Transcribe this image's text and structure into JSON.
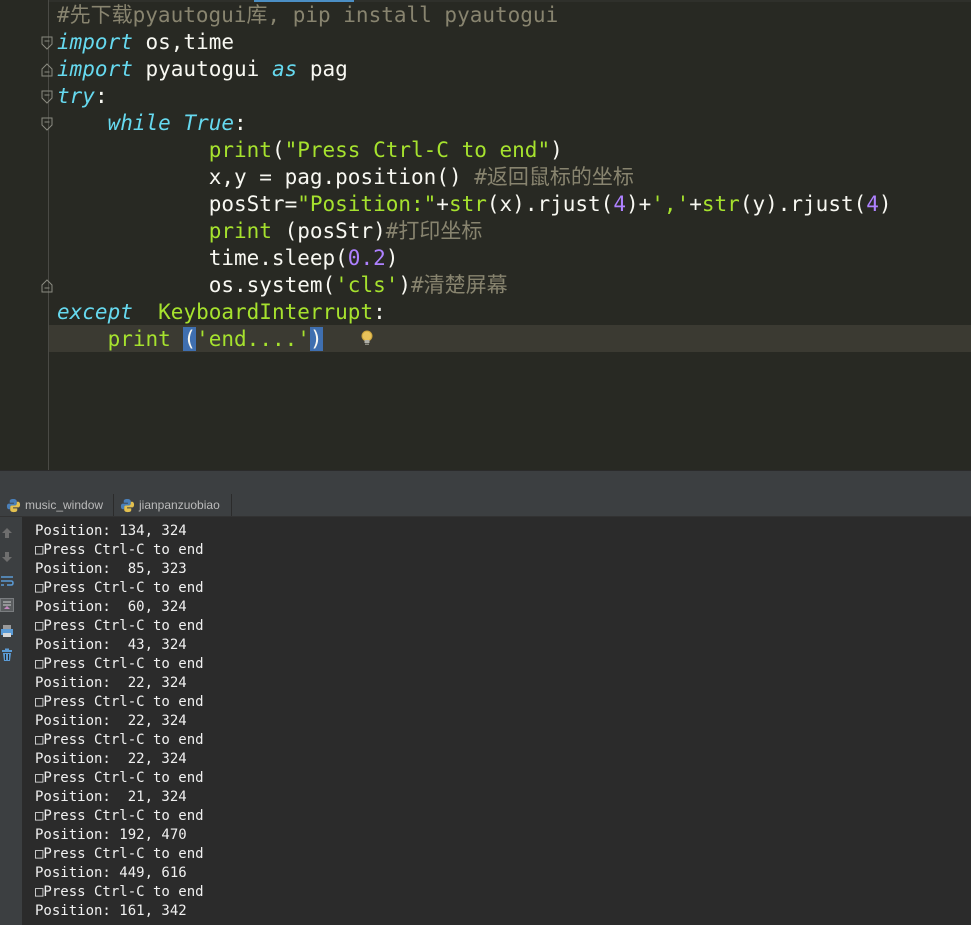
{
  "editor": {
    "lines": [
      [
        {
          "t": "#先下载pyautogui库, pip install pyautogui",
          "c": "c-cm"
        }
      ],
      [
        {
          "t": "import",
          "c": "c-kw"
        },
        {
          "t": " os,time",
          "c": ""
        }
      ],
      [
        {
          "t": "import",
          "c": "c-kw"
        },
        {
          "t": " pyautogui ",
          "c": ""
        },
        {
          "t": "as",
          "c": "c-kw"
        },
        {
          "t": " pag",
          "c": ""
        }
      ],
      [
        {
          "t": "try",
          "c": "c-kw"
        },
        {
          "t": ":",
          "c": ""
        }
      ],
      [
        {
          "t": "    ",
          "c": ""
        },
        {
          "t": "while",
          "c": "c-kw"
        },
        {
          "t": " ",
          "c": ""
        },
        {
          "t": "True",
          "c": "c-kw"
        },
        {
          "t": ":",
          "c": ""
        }
      ],
      [
        {
          "t": "            ",
          "c": ""
        },
        {
          "t": "print",
          "c": "c-fn"
        },
        {
          "t": "(",
          "c": ""
        },
        {
          "t": "\"Press Ctrl-C to end\"",
          "c": "c-str2"
        },
        {
          "t": ")",
          "c": ""
        }
      ],
      [
        {
          "t": "            x,y = pag.",
          "c": ""
        },
        {
          "t": "position",
          "c": ""
        },
        {
          "t": "() ",
          "c": ""
        },
        {
          "t": "#返回鼠标的坐标",
          "c": "c-cm"
        }
      ],
      [
        {
          "t": "            posStr=",
          "c": ""
        },
        {
          "t": "\"Position:\"",
          "c": "c-str2"
        },
        {
          "t": "+",
          "c": ""
        },
        {
          "t": "str",
          "c": "c-fn"
        },
        {
          "t": "(x).rjust(",
          "c": ""
        },
        {
          "t": "4",
          "c": "c-num"
        },
        {
          "t": ")+",
          "c": ""
        },
        {
          "t": "','",
          "c": "c-str2"
        },
        {
          "t": "+",
          "c": ""
        },
        {
          "t": "str",
          "c": "c-fn"
        },
        {
          "t": "(y).rjust(",
          "c": ""
        },
        {
          "t": "4",
          "c": "c-num"
        },
        {
          "t": ")",
          "c": ""
        }
      ],
      [
        {
          "t": "            ",
          "c": ""
        },
        {
          "t": "print",
          "c": "c-fn"
        },
        {
          "t": " (posStr)",
          "c": ""
        },
        {
          "t": "#打印坐标",
          "c": "c-cm"
        }
      ],
      [
        {
          "t": "            time.sleep(",
          "c": ""
        },
        {
          "t": "0.2",
          "c": "c-num"
        },
        {
          "t": ")",
          "c": ""
        }
      ],
      [
        {
          "t": "            os.system(",
          "c": ""
        },
        {
          "t": "'cls'",
          "c": "c-str2"
        },
        {
          "t": ")",
          "c": ""
        },
        {
          "t": "#清楚屏幕",
          "c": "c-cm"
        }
      ],
      [
        {
          "t": "except",
          "c": "c-kw"
        },
        {
          "t": "  ",
          "c": ""
        },
        {
          "t": "KeyboardInterrupt",
          "c": "c-fn"
        },
        {
          "t": ":",
          "c": ""
        }
      ],
      [
        {
          "t": "    ",
          "c": ""
        },
        {
          "t": "print",
          "c": "c-fn"
        },
        {
          "t": " ",
          "c": ""
        },
        {
          "t": "(",
          "c": "c-br-hl"
        },
        {
          "t": "'end....'",
          "c": "c-str2"
        },
        {
          "t": ")",
          "c": "c-br-hl"
        }
      ]
    ]
  },
  "run_tabs": [
    {
      "label": "music_window"
    },
    {
      "label": "jianpanzuobiao"
    }
  ],
  "console": {
    "lines": [
      "Position: 134, 324",
      "□Press Ctrl-C to end",
      "Position:  85, 323",
      "□Press Ctrl-C to end",
      "Position:  60, 324",
      "□Press Ctrl-C to end",
      "Position:  43, 324",
      "□Press Ctrl-C to end",
      "Position:  22, 324",
      "□Press Ctrl-C to end",
      "Position:  22, 324",
      "□Press Ctrl-C to end",
      "Position:  22, 324",
      "□Press Ctrl-C to end",
      "Position:  21, 324",
      "□Press Ctrl-C to end",
      "Position: 192, 470",
      "□Press Ctrl-C to end",
      "Position: 449, 616",
      "□Press Ctrl-C to end",
      "Position: 161, 342"
    ]
  },
  "icons": {
    "fold_markers": [
      "fold-icon",
      "fold-icon",
      "fold-icon",
      "fold-icon",
      "fold-icon",
      "fold-icon"
    ],
    "tools": [
      "arrow-up-icon",
      "arrow-down-icon",
      "soft-wrap-icon",
      "scroll-to-end-icon",
      "print-icon",
      "trash-icon"
    ],
    "hint": "lightbulb-icon",
    "tab": "python-icon"
  },
  "colors": {
    "editor_bg": "#282923",
    "keyword": "#66d9ef",
    "function": "#a6e22e",
    "comment": "#88846f",
    "number": "#ae81ff",
    "console_bg": "#2b2b2b"
  }
}
